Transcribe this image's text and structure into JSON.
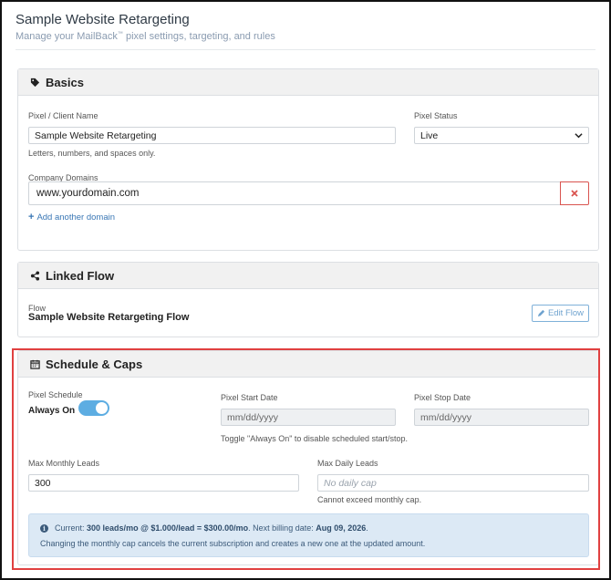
{
  "header": {
    "title": "Sample Website Retargeting",
    "subtitle_pre": "Manage your MailBack",
    "subtitle_tm": "™",
    "subtitle_post": " pixel settings, targeting, and rules"
  },
  "basics": {
    "heading": "Basics",
    "icon": "tag-icon",
    "client_name_label": "Pixel / Client Name",
    "client_name_value": "Sample Website Retargeting",
    "client_name_help": "Letters, numbers, and spaces only.",
    "status_label": "Pixel Status",
    "status_value": "Live",
    "domains_label": "Company Domains",
    "domain_value": "www.yourdomain.com",
    "add_domain_label": "Add another domain"
  },
  "linked_flow": {
    "heading": "Linked Flow",
    "icon": "share-icon",
    "flow_label": "Flow",
    "flow_name": "Sample Website Retargeting Flow",
    "edit_label": "Edit Flow"
  },
  "schedule": {
    "heading": "Schedule & Caps",
    "icon": "calendar-icon",
    "schedule_label": "Pixel Schedule",
    "always_on_label": "Always On",
    "always_on": true,
    "start_label": "Pixel Start Date",
    "start_placeholder": "mm/dd/yyyy",
    "stop_label": "Pixel Stop Date",
    "stop_placeholder": "mm/dd/yyyy",
    "date_help": "Toggle \"Always On\" to disable scheduled start/stop.",
    "monthly_label": "Max Monthly Leads",
    "monthly_value": "300",
    "daily_label": "Max Daily Leads",
    "daily_placeholder": "No daily cap",
    "daily_help": "Cannot exceed monthly cap.",
    "info": {
      "current_prefix": "Current: ",
      "current_value": "300 leads/mo @ $1.000/lead = $300.00/mo",
      "billing_prefix": ". Next billing date: ",
      "billing_date": "Aug 09, 2026",
      "billing_suffix": ".",
      "note": "Changing the monthly cap cancels the current subscription and creates a new one at the updated amount."
    }
  },
  "colors": {
    "accent": "#5dade2",
    "highlight_border": "#e04040",
    "link": "#3a77b5",
    "danger": "#d9534f",
    "info_bg": "#dce9f5"
  }
}
